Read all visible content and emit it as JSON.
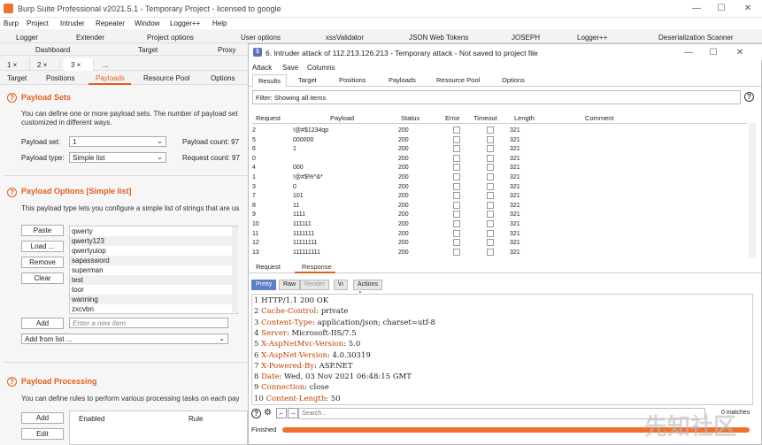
{
  "app": {
    "title": "Burp Suite Professional v2021.5.1 - Temporary Project - licensed to google",
    "window_controls": [
      "—",
      "☐",
      "✕"
    ]
  },
  "menu": [
    "Burp",
    "Project",
    "Intruder",
    "Repeater",
    "Window",
    "Logger++",
    "Help"
  ],
  "top_tabs_row1": [
    "Logger",
    "Extender",
    "Project options",
    "User options",
    "xssValidator",
    "JSON Web Tokens",
    "JOSEPH",
    "Logger++",
    "Deserialization Scanner"
  ],
  "top_tabs_row2": [
    "Dashboard",
    "Target",
    "Proxy"
  ],
  "subtabs": [
    "1 ×",
    "2 ×",
    "3 ×",
    "..."
  ],
  "intruder_tabs": [
    "Target",
    "Positions",
    "Payloads",
    "Resource Pool",
    "Options"
  ],
  "payload_sets": {
    "heading": "Payload Sets",
    "desc1": "You can define one or more payload sets. The number of payload set",
    "desc2": "customized in different ways.",
    "set_label": "Payload set:",
    "set_value": "1",
    "count_label": "Payload count: 97",
    "type_label": "Payload type:",
    "type_value": "Simple list",
    "request_label": "Request count: 97"
  },
  "payload_options": {
    "heading": "Payload Options [Simple list]",
    "desc": "This payload type lets you configure a simple list of strings that are us",
    "buttons": [
      "Paste",
      "Load ...",
      "Remove",
      "Clear"
    ],
    "items": [
      "qwerty",
      "qwerty123",
      "qwertyuiop",
      "sapassword",
      "superman",
      "test",
      "toor",
      "wanning",
      "zxcvbn"
    ],
    "add_button": "Add",
    "add_placeholder": "Enter a new item",
    "add_from_list": "Add from list ..."
  },
  "payload_processing": {
    "heading": "Payload Processing",
    "desc": "You can define rules to perform various processing tasks on each pay",
    "add_button": "Add",
    "edit_button": "Edit",
    "col_enabled": "Enabled",
    "col_rule": "Rule"
  },
  "intruder_window": {
    "title": "6. Intruder attack of 112.213.126.213 - Temporary attack - Not saved to project file",
    "menu": [
      "Attack",
      "Save",
      "Columns"
    ],
    "tabs": [
      "Results",
      "Target",
      "Positions",
      "Payloads",
      "Resource Pool",
      "Options"
    ],
    "filter": "Filter: Showing all items",
    "columns": [
      "Request",
      "Payload",
      "Status",
      "Error",
      "Timeout",
      "Length",
      "Comment"
    ],
    "rows": [
      {
        "req": "2",
        "payload": "!@#$1234qp",
        "status": "200",
        "length": "321"
      },
      {
        "req": "5",
        "payload": "000000",
        "status": "200",
        "length": "321"
      },
      {
        "req": "6",
        "payload": "1",
        "status": "200",
        "length": "321"
      },
      {
        "req": "0",
        "payload": "",
        "status": "200",
        "length": "321"
      },
      {
        "req": "4",
        "payload": "000",
        "status": "200",
        "length": "321"
      },
      {
        "req": "1",
        "payload": "!@#$%^&*",
        "status": "200",
        "length": "321"
      },
      {
        "req": "3",
        "payload": "0",
        "status": "200",
        "length": "321"
      },
      {
        "req": "7",
        "payload": "101",
        "status": "200",
        "length": "321"
      },
      {
        "req": "8",
        "payload": "11",
        "status": "200",
        "length": "321"
      },
      {
        "req": "9",
        "payload": "1111",
        "status": "200",
        "length": "321"
      },
      {
        "req": "10",
        "payload": "111111",
        "status": "200",
        "length": "321"
      },
      {
        "req": "11",
        "payload": "1111111",
        "status": "200",
        "length": "321"
      },
      {
        "req": "12",
        "payload": "11111111",
        "status": "200",
        "length": "321"
      },
      {
        "req": "13",
        "payload": "111111111",
        "status": "200",
        "length": "321"
      }
    ],
    "rr_tabs": [
      "Request",
      "Response"
    ],
    "view_buttons": [
      "Pretty",
      "Raw",
      "Render",
      "\\n",
      "Actions ⌄"
    ],
    "response_lines": [
      {
        "n": "1",
        "k": "",
        "v": "HTTP/1.1 200 OK"
      },
      {
        "n": "2",
        "k": "Cache-Control",
        "v": ": private"
      },
      {
        "n": "3",
        "k": "Content-Type",
        "v": ": application/json; charset=utf-8"
      },
      {
        "n": "4",
        "k": "Server",
        "v": ": Microsoft-IIS/7.5"
      },
      {
        "n": "5",
        "k": "X-AspNetMvc-Version",
        "v": ": 5.0"
      },
      {
        "n": "6",
        "k": "X-AspNet-Version",
        "v": ": 4.0.30319"
      },
      {
        "n": "7",
        "k": "X-Powered-By",
        "v": ": ASP.NET"
      },
      {
        "n": "8",
        "k": "Date",
        "v": ": Wed, 03 Nov 2021 06:48:15 GMT"
      },
      {
        "n": "9",
        "k": "Connection",
        "v": ": close"
      },
      {
        "n": "10",
        "k": "Content-Length",
        "v": ": 50"
      }
    ],
    "search_placeholder": "Search...",
    "matches": "0 matches",
    "status": "Finished",
    "progress": 1.0
  },
  "watermark": "先知社区",
  "colors": {
    "accent": "#e06020",
    "pretty": "#5a7fc8"
  }
}
